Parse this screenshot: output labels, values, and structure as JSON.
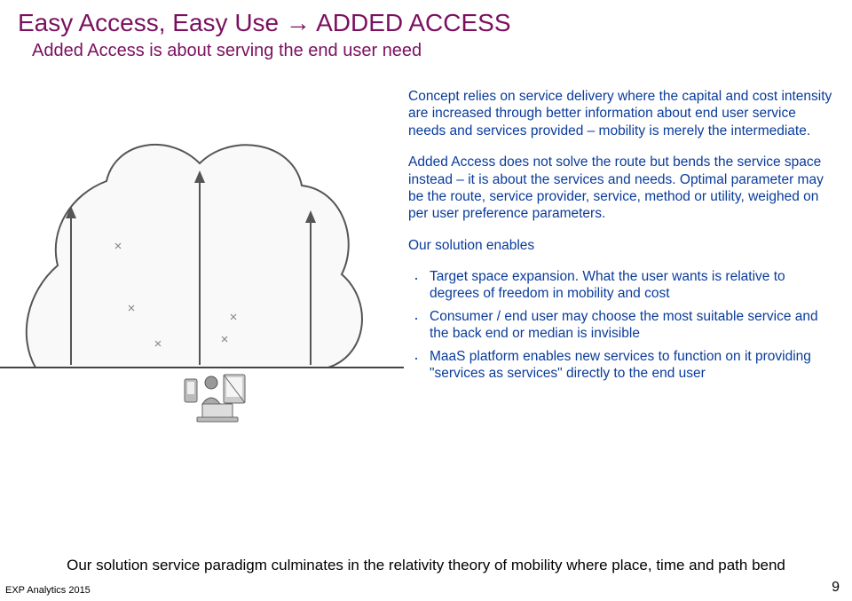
{
  "title": "Easy Access, Easy Use → ADDED ACCESS",
  "subtitle": "Added Access is about serving the end user need",
  "para1": "Concept relies on service delivery where the capital and cost intensity are increased through better information about end user service needs and services provided – mobility is merely the intermediate.",
  "para2": "Added Access does not solve the route but bends the service space instead – it is about the services and needs. Optimal parameter may be the route, service provider, service, method or utility, weighed on per user preference parameters.",
  "enables_label": "Our solution enables",
  "bullets": [
    "Target space expansion. What the user wants is relative to degrees of freedom in mobility and cost",
    "Consumer / end user may choose the most suitable service and the back end or median is invisible",
    "MaaS platform enables new services to function on it providing \"services as services\" directly to the end user"
  ],
  "bottomline": "Our solution service paradigm culminates in the relativity theory of mobility where place, time and path bend",
  "footer_left": "EXP Analytics 2015",
  "page_number": "9"
}
